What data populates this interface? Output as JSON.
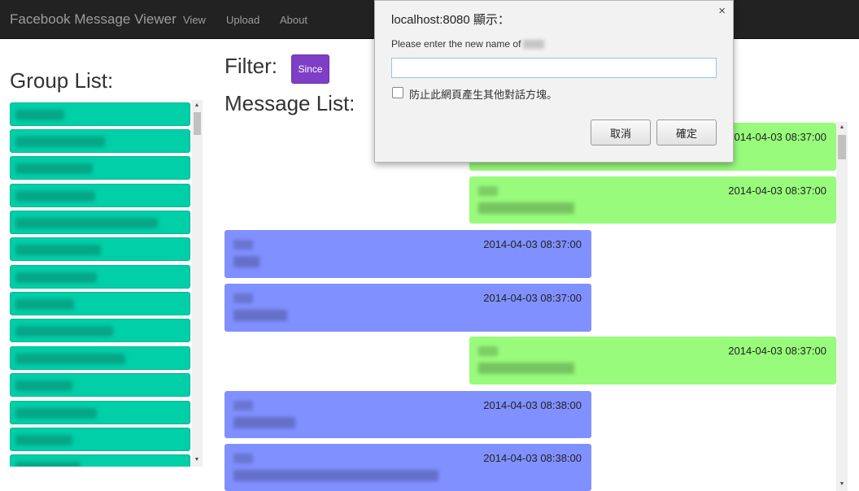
{
  "navbar": {
    "brand": "Facebook Message Viewer",
    "links": [
      "View",
      "Upload",
      "About"
    ]
  },
  "group_list": {
    "title": "Group List:",
    "items": [
      {
        "label_blurred": true
      },
      {
        "label_blurred": true
      },
      {
        "label_blurred": true
      },
      {
        "label_blurred": true
      },
      {
        "label_blurred": true
      },
      {
        "label_blurred": true
      },
      {
        "label_blurred": true
      },
      {
        "label_blurred": true
      },
      {
        "label_blurred": true
      },
      {
        "label_blurred": true
      },
      {
        "label_blurred": true
      },
      {
        "label_blurred": true
      },
      {
        "label_blurred": true
      },
      {
        "label_blurred": true
      }
    ]
  },
  "filter": {
    "title": "Filter:",
    "since_button": "Since"
  },
  "messages": {
    "title": "Message List:",
    "items": [
      {
        "side": "me",
        "time": "2014-04-03 08:37:00"
      },
      {
        "side": "me",
        "time": "2014-04-03 08:37:00"
      },
      {
        "side": "other",
        "time": "2014-04-03 08:37:00"
      },
      {
        "side": "other",
        "time": "2014-04-03 08:37:00"
      },
      {
        "side": "me",
        "time": "2014-04-03 08:37:00"
      },
      {
        "side": "other",
        "time": "2014-04-03 08:38:00"
      },
      {
        "side": "other",
        "time": "2014-04-03 08:38:00"
      }
    ]
  },
  "dialog": {
    "title": "localhost:8080 顯示：",
    "close": "×",
    "message": "Please enter the new name of",
    "input_value": "",
    "checkbox_label": "防止此網頁產生其他對話方塊。",
    "cancel_button": "取消",
    "ok_button": "確定"
  },
  "colors": {
    "navbar": "#222222",
    "group_item": "#00cfa8",
    "msg_me": "#98fb7c",
    "msg_other": "#8090ff",
    "since_button": "#7e3fc6"
  }
}
